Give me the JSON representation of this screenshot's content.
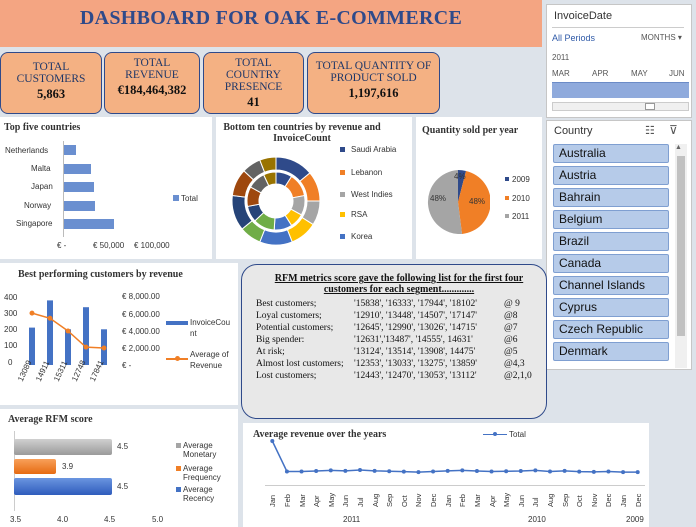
{
  "header": {
    "title": "DASHBOARD FOR OAK E-COMMERCE"
  },
  "kpis": [
    {
      "label": "TOTAL CUSTOMERS",
      "value": "5,863"
    },
    {
      "label": "TOTAL REVENUE",
      "value": "€184,464,382"
    },
    {
      "label": "TOTAL COUNTRY PRESENCE",
      "value": "41"
    },
    {
      "label": "TOTAL QUANTITY OF PRODUCT SOLD",
      "value": "1,197,616"
    }
  ],
  "invoice_slicer": {
    "title": "InvoiceDate",
    "period_filter": "All Periods",
    "level": "MONTHS",
    "year": "2011",
    "months": [
      "MAR",
      "APR",
      "MAY",
      "JUN"
    ]
  },
  "country_slicer": {
    "title": "Country",
    "items": [
      "Australia",
      "Austria",
      "Bahrain",
      "Belgium",
      "Brazil",
      "Canada",
      "Channel Islands",
      "Cyprus",
      "Czech Republic",
      "Denmark"
    ]
  },
  "top5": {
    "title": "Top five countries",
    "categories": [
      "Netherlands",
      "Malta",
      "Japan",
      "Norway",
      "Singapore"
    ],
    "ticks": [
      "€ -",
      "€ 50,000",
      "€ 100,000"
    ],
    "legend": "Total"
  },
  "bottom10": {
    "title": "Bottom ten countries by revenue and InvoiceCount",
    "legend": [
      "Saudi Arabia",
      "Lebanon",
      "West Indies",
      "RSA",
      "Korea"
    ]
  },
  "qty": {
    "title": "Quantity sold per year",
    "legend": [
      "2009",
      "2010",
      "2011"
    ],
    "labels": [
      "4%",
      "48%",
      "48%"
    ]
  },
  "best": {
    "title": "Best performing customers by revenue",
    "left_ticks": [
      "400",
      "300",
      "200",
      "100",
      "0"
    ],
    "right_ticks": [
      "€ 8,000.00",
      "€ 6,000.00",
      "€ 4,000.00",
      "€ 2,000.00",
      "€ -"
    ],
    "categories": [
      "13089",
      "14911",
      "15311",
      "12748",
      "17841"
    ],
    "legend_bar": "InvoiceCount",
    "legend_line": "Average of Revenue"
  },
  "rfm": {
    "title": "RFM metrics score gave the following list for the first four customers for each segment.............",
    "rows": [
      {
        "seg": "Best customers;",
        "ids": "'15838', '16333', '17944', '18102'",
        "score": "@ 9"
      },
      {
        "seg": "Loyal customers;",
        "ids": "'12910', '13448', '14507', '17147'",
        "score": "@8"
      },
      {
        "seg": "Potential customers;",
        "ids": "'12645', '12990', '13026', '14715'",
        "score": "@7"
      },
      {
        "seg": "Big spender:",
        "ids": "'12631','13487', '14555', 14631'",
        "score": "@6"
      },
      {
        "seg": "At risk;",
        "ids": "'13124', '13514', '13908', 14475'",
        "score": "@5"
      },
      {
        "seg": "Almost lost customers;",
        "ids": "'12353', '13033', '13275', '13859'",
        "score": "@4,3"
      },
      {
        "seg": "Lost customers;",
        "ids": "'12443', '12470', '13053', '13112'",
        "score": "@2,1,0"
      }
    ]
  },
  "avg_rfm": {
    "title": "Average RFM score",
    "ticks": [
      "3.5",
      "4.0",
      "4.5",
      "5.0"
    ],
    "legend": [
      "Average Monetary",
      "Average Frequency",
      "Average Recency"
    ]
  },
  "avg_rev": {
    "title": "Average revenue over the years",
    "legend": "Total",
    "months": [
      "Jan",
      "Feb",
      "Mar",
      "Apr",
      "May",
      "Jun",
      "Jul",
      "Aug",
      "Sep",
      "Oct",
      "Nov",
      "Dec",
      "Jan",
      "Feb",
      "Mar",
      "Apr",
      "May",
      "Jun",
      "Jul",
      "Aug",
      "Sep",
      "Oct",
      "Nov",
      "Dec",
      "Jan",
      "Dec"
    ],
    "years": [
      "2011",
      "2010",
      "2009"
    ]
  },
  "chart_data": [
    {
      "type": "bar",
      "title": "Top five countries",
      "categories": [
        "Netherlands",
        "Malta",
        "Japan",
        "Norway",
        "Singapore"
      ],
      "values": [
        13000,
        28000,
        31000,
        32000,
        52000
      ],
      "series": [
        {
          "name": "Total"
        }
      ]
    },
    {
      "type": "pie",
      "title": "Bottom ten countries by revenue and InvoiceCount",
      "categories": [
        "Saudi Arabia",
        "Lebanon",
        "West Indies",
        "RSA",
        "Korea"
      ]
    },
    {
      "type": "pie",
      "title": "Quantity sold per year",
      "categories": [
        "2009",
        "2010",
        "2011"
      ],
      "values": [
        4,
        48,
        48
      ]
    },
    {
      "type": "bar",
      "title": "Best performing customers by revenue",
      "categories": [
        "13089",
        "14911",
        "15311",
        "12748",
        "17841"
      ],
      "series": [
        {
          "name": "InvoiceCount",
          "values": [
            220,
            380,
            210,
            340,
            210
          ]
        },
        {
          "name": "Average of Revenue",
          "values": [
            6100,
            5500,
            4000,
            2100,
            2000
          ]
        }
      ]
    },
    {
      "type": "bar",
      "title": "Average RFM score",
      "categories": [
        "Average Monetary",
        "Average Frequency",
        "Average Recency"
      ],
      "values": [
        4.5,
        3.9,
        4.5
      ],
      "xlim": [
        3.5,
        5.0
      ]
    },
    {
      "type": "line",
      "title": "Average revenue over the years",
      "series": [
        {
          "name": "Total",
          "values": [
            2,
            0.55,
            0.55,
            0.57,
            0.6,
            0.58,
            0.62,
            0.58,
            0.56,
            0.54,
            0.52,
            0.55,
            0.58,
            0.6,
            0.57,
            0.55,
            0.56,
            0.57,
            0.6,
            0.55,
            0.58,
            0.54,
            0.53,
            0.55,
            0.52,
            0.52
          ]
        }
      ]
    }
  ]
}
